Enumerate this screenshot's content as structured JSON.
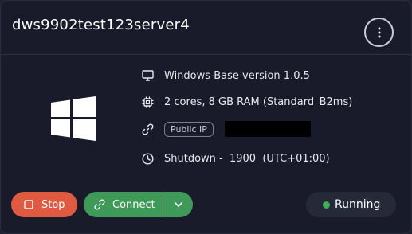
{
  "server": {
    "name": "dws9902test123server4"
  },
  "icons": {
    "menu": "kebab-menu-icon",
    "os": "windows-logo-icon",
    "monitor": "monitor-icon",
    "cpu": "cpu-icon",
    "link": "link-icon",
    "clock": "clock-icon",
    "stop": "stop-square-icon",
    "connect": "link-icon",
    "chevron": "chevron-down-icon"
  },
  "details": {
    "os": "Windows-Base version 1.0.5",
    "size": "2 cores, 8 GB RAM (Standard_B2ms)",
    "ip_label": "Public IP",
    "shutdown": "Shutdown -  1900  (UTC+01:00)"
  },
  "actions": {
    "stop_label": "Stop",
    "connect_label": "Connect"
  },
  "status": {
    "label": "Running",
    "color": "#3fae55"
  },
  "colors": {
    "stop": "#e05a41",
    "connect": "#3f9a5a",
    "background": "#191b2a"
  }
}
